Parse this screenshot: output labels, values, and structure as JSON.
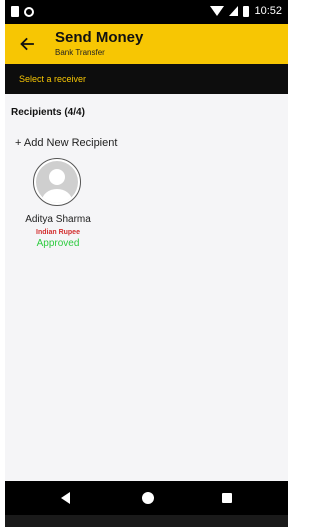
{
  "status_bar": {
    "time": "10:52",
    "icons": [
      "sim-icon",
      "notification-circle-icon",
      "wifi-icon",
      "signal-icon",
      "battery-icon"
    ]
  },
  "app_bar": {
    "back_icon": "arrow-left-icon",
    "title": "Send Money",
    "subtitle": "Bank Transfer",
    "background": "#f7c603"
  },
  "select_bar": {
    "label": "Select a receiver",
    "label_color": "#f7c603"
  },
  "recipients": {
    "header": "Recipients (4/4)",
    "add_label": "+ Add New Recipient",
    "items": [
      {
        "name": "Aditya Sharma",
        "currency": "Indian Rupee",
        "status": "Approved",
        "avatar_icon": "user-placeholder-icon"
      }
    ]
  },
  "nav_bar": {
    "icons": [
      "nav-back-icon",
      "nav-home-icon",
      "nav-recents-icon"
    ]
  }
}
